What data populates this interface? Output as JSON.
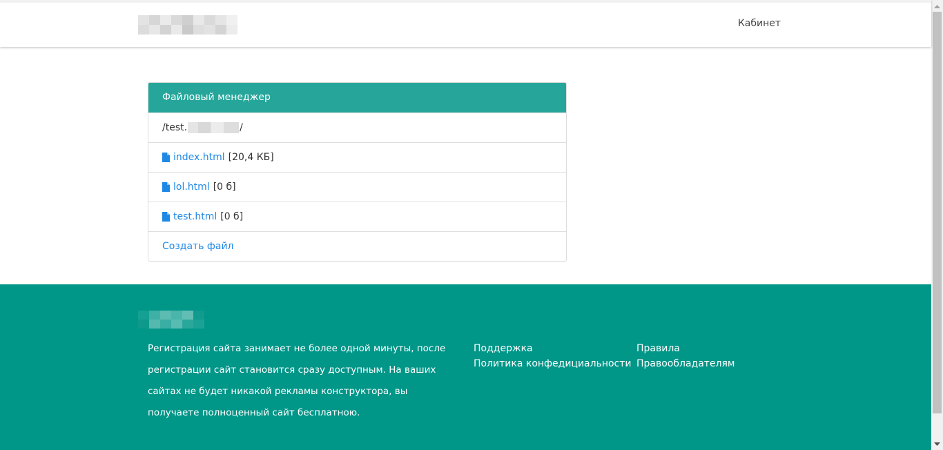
{
  "navbar": {
    "cabinet_label": "Кабинет"
  },
  "file_manager": {
    "title": "Файловый менеджер",
    "path_prefix": "/test.",
    "path_suffix": "/",
    "files": [
      {
        "name": "index.html",
        "size": "[20,4 КБ]",
        "icon": "file-icon"
      },
      {
        "name": "lol.html",
        "size": "[0 б]",
        "icon": "file-icon"
      },
      {
        "name": "test.html",
        "size": "[0 б]",
        "icon": "file-icon"
      }
    ],
    "create_label": "Создать файл"
  },
  "footer": {
    "description": "Регистрация сайта занимает не более одной минуты, после регистрации сайт становится сразу доступным. На ваших сайтах не будет никакой рекламы конструктора, вы получаете полноценный сайт бесплатною.",
    "links_col1": [
      "Поддержка",
      "Политика конфедициальности"
    ],
    "links_col2": [
      "Правила",
      "Правообладателям"
    ]
  },
  "colors": {
    "panel_header": "#26a69a",
    "footer_bg": "#009688",
    "link": "#1e88e5"
  }
}
